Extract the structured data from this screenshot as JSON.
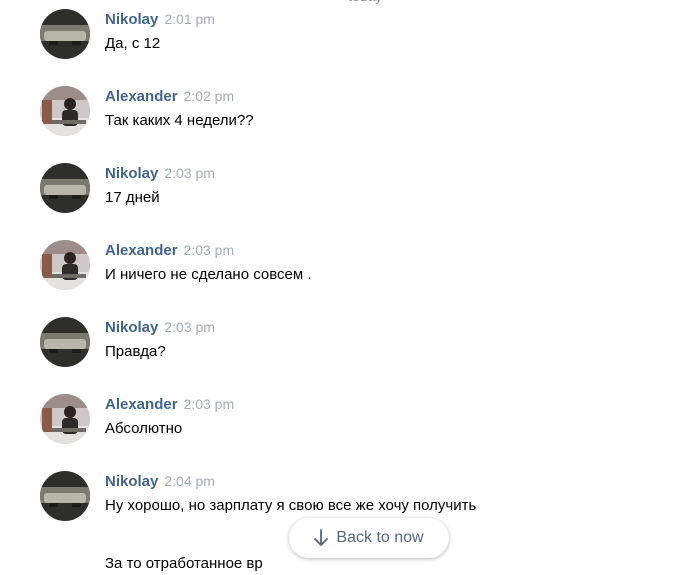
{
  "date_separator": "today",
  "messages": [
    {
      "author": "Nikolay",
      "time": "2:01 pm",
      "text": "Да, с 12"
    },
    {
      "author": "Alexander",
      "time": "2:02 pm",
      "text": "Так каких 4 недели??"
    },
    {
      "author": "Nikolay",
      "time": "2:03 pm",
      "text": "17 дней"
    },
    {
      "author": "Alexander",
      "time": "2:03 pm",
      "text": "И ничего не сделано совсем ."
    },
    {
      "author": "Nikolay",
      "time": "2:03 pm",
      "text": "Правда?"
    },
    {
      "author": "Alexander",
      "time": "2:03 pm",
      "text": "Абсолютно"
    },
    {
      "author": "Nikolay",
      "time": "2:04 pm",
      "text": "Ну хорошо, но зарплату я свою все же хочу получить",
      "text2": "За то отработанное вр"
    }
  ],
  "back_button": {
    "label": "Back to now",
    "icon": "arrow-down-icon"
  },
  "colors": {
    "author": "#42648b",
    "time": "#a3adba",
    "button_text": "#55677d"
  }
}
